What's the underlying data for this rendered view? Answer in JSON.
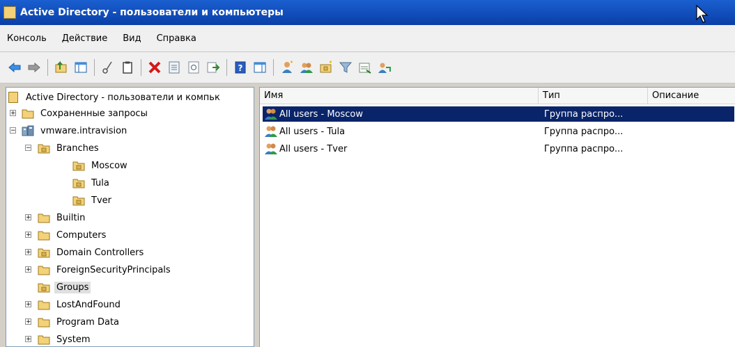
{
  "window": {
    "title": "Active Directory - пользователи и компьютеры"
  },
  "menu": {
    "items": [
      "Консоль",
      "Действие",
      "Вид",
      "Справка"
    ]
  },
  "toolbar": {
    "buttons": [
      "back-arrow-icon",
      "forward-arrow-icon",
      "up-folder-icon",
      "show-hide-tree-icon",
      "cut-icon",
      "paste-icon",
      "delete-icon",
      "properties-icon",
      "refresh-icon",
      "export-list-icon",
      "help-icon",
      "action-pane-icon",
      "new-user-icon",
      "new-group-icon",
      "new-ou-icon",
      "filter-icon",
      "find-icon",
      "add-to-group-icon"
    ]
  },
  "tree": {
    "root": "Active Directory - пользователи и компьк",
    "saved_queries": "Сохраненные запросы",
    "domain": "vmware.intravision",
    "branches": "Branches",
    "moscow": "Moscow",
    "tula": "Tula",
    "tver": "Tver",
    "builtin": "Builtin",
    "computers": "Computers",
    "domain_controllers": "Domain Controllers",
    "foreign": "ForeignSecurityPrincipals",
    "groups": "Groups",
    "lostandfound": "LostAndFound",
    "program_data": "Program Data",
    "system": "System"
  },
  "list": {
    "columns": {
      "name": "Имя",
      "type": "Тип",
      "description": "Описание"
    },
    "rows": [
      {
        "name": "All users - Moscow",
        "type": "Группа распро..."
      },
      {
        "name": "All users - Tula",
        "type": "Группа распро..."
      },
      {
        "name": "All users - Tver",
        "type": "Группа распро..."
      }
    ]
  }
}
